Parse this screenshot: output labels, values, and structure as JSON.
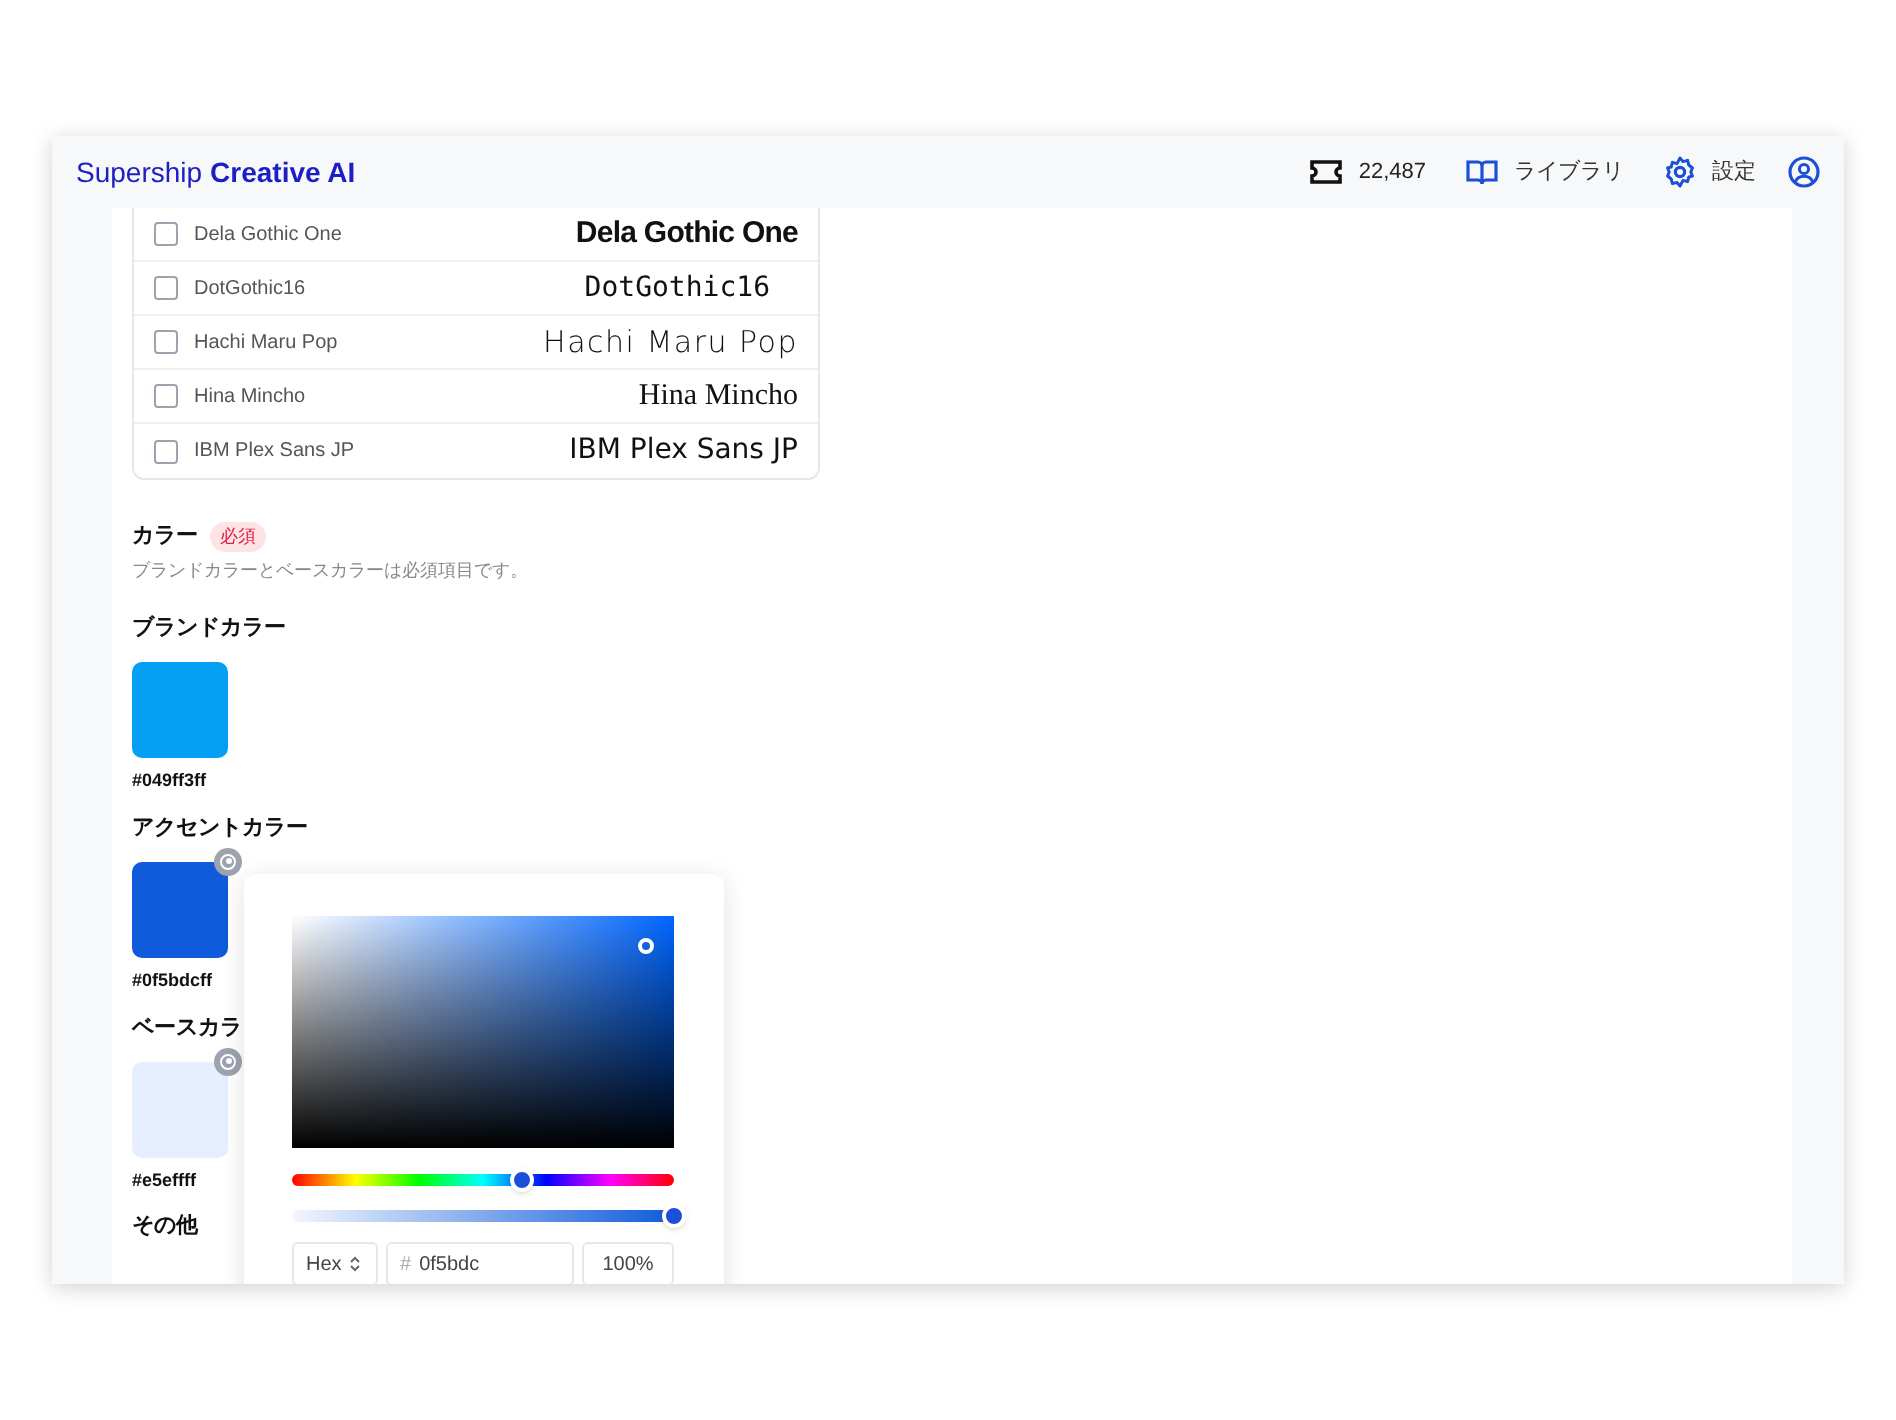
{
  "header": {
    "logo_light": "Supership",
    "logo_bold": "Creative AI",
    "credits": "22,487",
    "library": "ライブラリ",
    "settings": "設定"
  },
  "fonts": [
    {
      "name": "Dela Gothic One",
      "sample": "Dela Gothic One",
      "kind": "heavy",
      "checked": false
    },
    {
      "name": "DotGothic16",
      "sample": "DotGothic16",
      "kind": "pixel",
      "checked": false
    },
    {
      "name": "Hachi Maru Pop",
      "sample": "Hachi Maru Pop",
      "kind": "round",
      "checked": false
    },
    {
      "name": "Hina Mincho",
      "sample": "Hina Mincho",
      "kind": "serif",
      "checked": false
    },
    {
      "name": "IBM Plex Sans JP",
      "sample": "IBM Plex Sans JP",
      "kind": "sans",
      "checked": false
    }
  ],
  "color_section": {
    "title": "カラー",
    "badge": "必須",
    "description": "ブランドカラーとベースカラーは必須項目です。"
  },
  "colors": [
    {
      "label": "ブランドカラー",
      "hex": "#049ff3ff",
      "color": "#049ff3",
      "removable": false
    },
    {
      "label": "アクセントカラー",
      "hex": "#0f5bdcff",
      "color": "#0f5bdc",
      "removable": true
    },
    {
      "label": "ベースカラ",
      "hex": "#e5effff",
      "color": "#e5efff",
      "removable": true
    }
  ],
  "other_label": "その他",
  "picker": {
    "hue": {
      "level": 0.6
    },
    "alpha": {
      "level": 1
    },
    "format": "Hex",
    "hex_prefix": "#",
    "hex_value": "0f5bdc",
    "opacity": "100%"
  }
}
